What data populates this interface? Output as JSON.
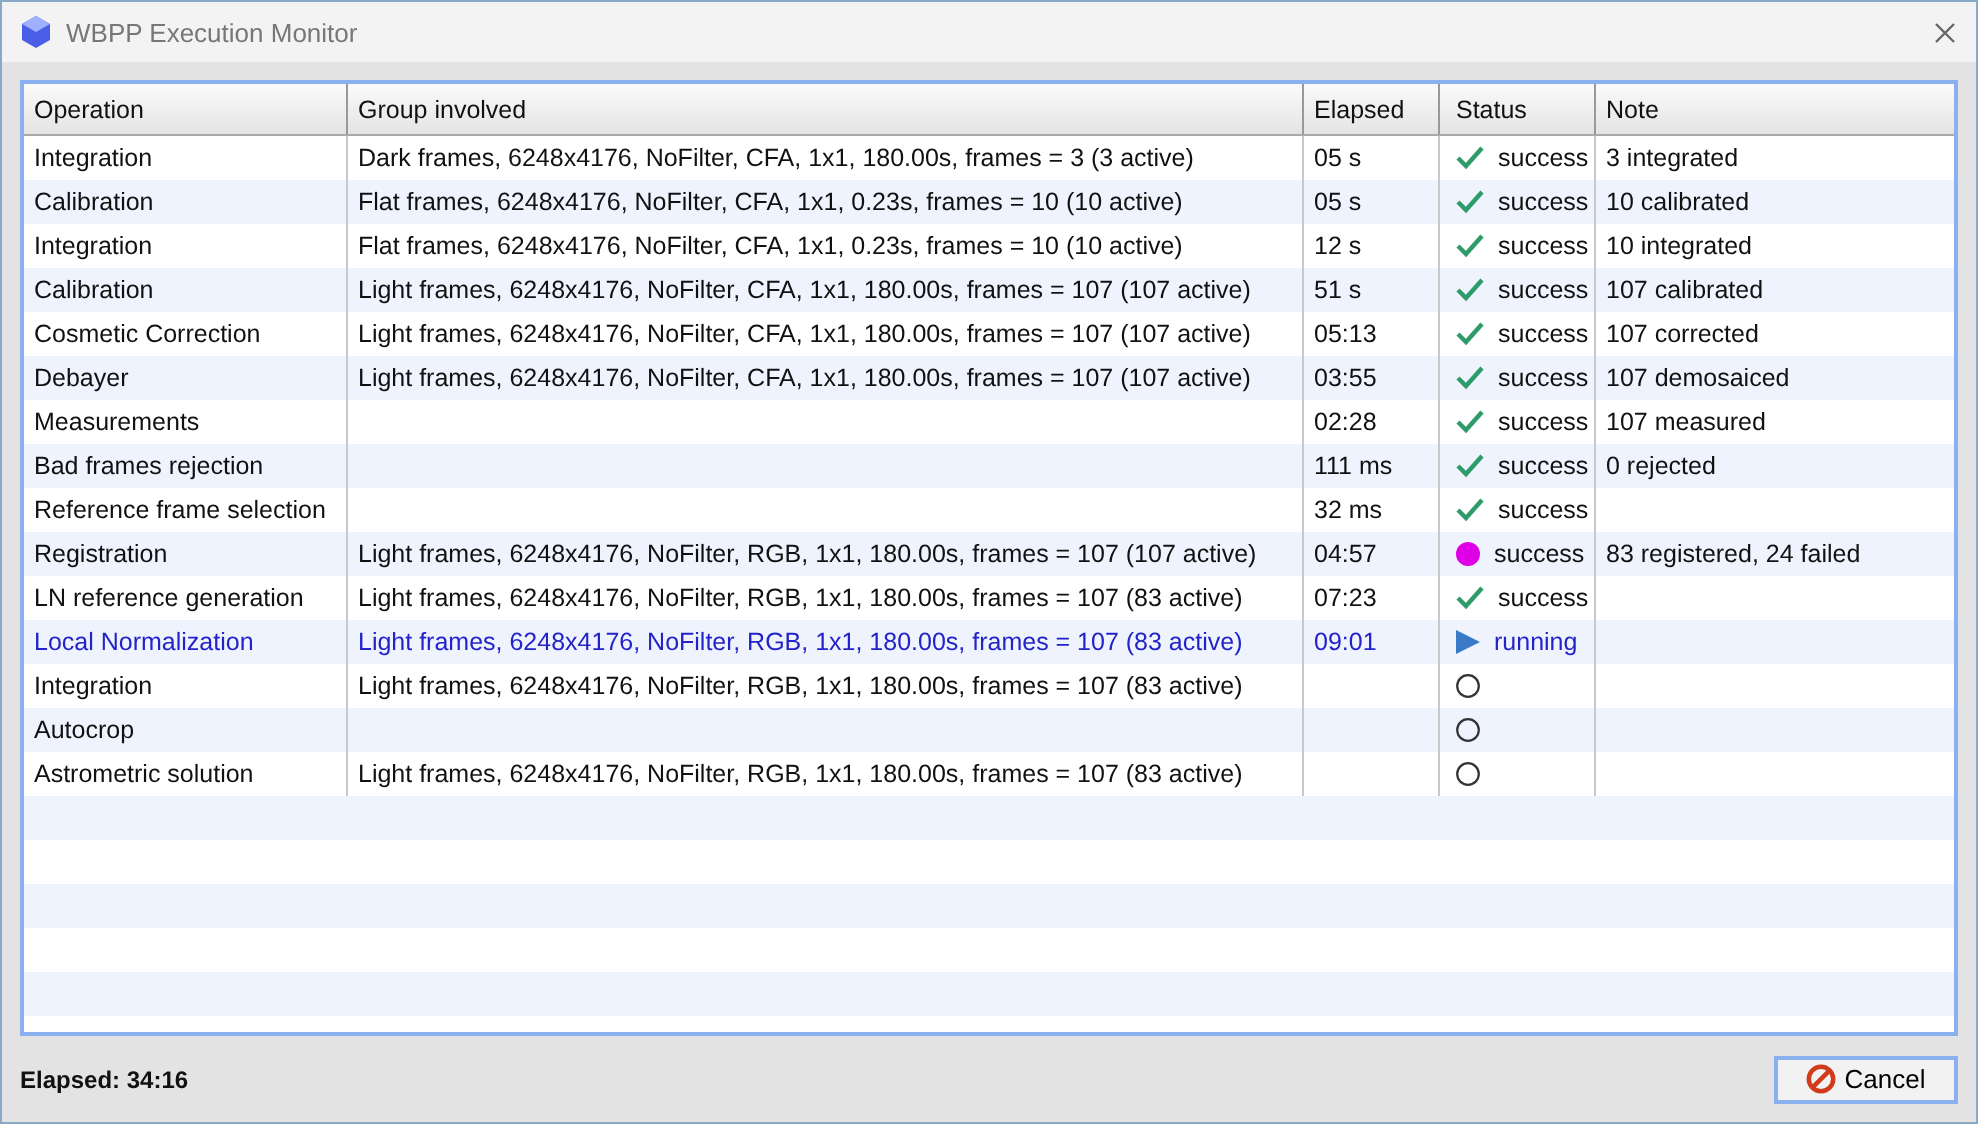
{
  "window": {
    "title": "WBPP Execution Monitor"
  },
  "table": {
    "columns": [
      "Operation",
      "Group involved",
      "Elapsed",
      "Status",
      "Note"
    ],
    "rows": [
      {
        "operation": "Integration",
        "group": "Dark frames, 6248x4176, NoFilter, CFA, 1x1, 180.00s, frames = 3 (3 active)",
        "elapsed": "05 s",
        "status": {
          "kind": "check",
          "label": "success"
        },
        "note": "3 integrated",
        "active": false
      },
      {
        "operation": "Calibration",
        "group": "Flat frames, 6248x4176, NoFilter, CFA, 1x1, 0.23s, frames = 10 (10 active)",
        "elapsed": "05 s",
        "status": {
          "kind": "check",
          "label": "success"
        },
        "note": "10 calibrated",
        "active": false
      },
      {
        "operation": "Integration",
        "group": "Flat frames, 6248x4176, NoFilter, CFA, 1x1, 0.23s, frames = 10 (10 active)",
        "elapsed": "12 s",
        "status": {
          "kind": "check",
          "label": "success"
        },
        "note": "10 integrated",
        "active": false
      },
      {
        "operation": "Calibration",
        "group": "Light frames, 6248x4176, NoFilter, CFA, 1x1, 180.00s, frames = 107 (107 active)",
        "elapsed": "51 s",
        "status": {
          "kind": "check",
          "label": "success"
        },
        "note": "107 calibrated",
        "active": false
      },
      {
        "operation": "Cosmetic Correction",
        "group": "Light frames, 6248x4176, NoFilter, CFA, 1x1, 180.00s, frames = 107 (107 active)",
        "elapsed": "05:13",
        "status": {
          "kind": "check",
          "label": "success"
        },
        "note": "107 corrected",
        "active": false
      },
      {
        "operation": "Debayer",
        "group": "Light frames, 6248x4176, NoFilter, CFA, 1x1, 180.00s, frames = 107 (107 active)",
        "elapsed": "03:55",
        "status": {
          "kind": "check",
          "label": "success"
        },
        "note": "107 demosaiced",
        "active": false
      },
      {
        "operation": "Measurements",
        "elapsed": "02:28",
        "status": {
          "kind": "check",
          "label": "success"
        },
        "note": "107 measured",
        "active": false
      },
      {
        "operation": "Bad frames rejection",
        "elapsed": "111 ms",
        "status": {
          "kind": "check",
          "label": "success"
        },
        "note": "0 rejected",
        "active": false
      },
      {
        "operation": "Reference frame selection",
        "elapsed": "32 ms",
        "status": {
          "kind": "check",
          "label": "success"
        },
        "active": false
      },
      {
        "operation": "Registration",
        "group": "Light frames, 6248x4176, NoFilter, RGB, 1x1, 180.00s, frames = 107 (107 active)",
        "elapsed": "04:57",
        "status": {
          "kind": "dot",
          "label": "success"
        },
        "note": "83 registered, 24 failed",
        "active": false
      },
      {
        "operation": "LN reference generation",
        "group": "Light frames, 6248x4176, NoFilter, RGB, 1x1, 180.00s, frames = 107 (83 active)",
        "elapsed": "07:23",
        "status": {
          "kind": "check",
          "label": "success"
        },
        "active": false
      },
      {
        "operation": "Local Normalization",
        "group": "Light frames, 6248x4176, NoFilter, RGB, 1x1, 180.00s, frames = 107 (83 active)",
        "elapsed": "09:01",
        "status": {
          "kind": "play",
          "label": "running"
        },
        "active": true
      },
      {
        "operation": "Integration",
        "group": "Light frames, 6248x4176, NoFilter, RGB, 1x1, 180.00s, frames = 107 (83 active)",
        "status": {
          "kind": "pending"
        },
        "active": false
      },
      {
        "operation": "Autocrop",
        "status": {
          "kind": "pending"
        },
        "active": false
      },
      {
        "operation": "Astrometric solution",
        "group": "Light frames, 6248x4176, NoFilter, RGB, 1x1, 180.00s, frames = 107 (83 active)",
        "status": {
          "kind": "pending"
        },
        "active": false
      }
    ]
  },
  "footer": {
    "elapsed": "Elapsed: 34:16",
    "cancel_button": "Cancel"
  }
}
